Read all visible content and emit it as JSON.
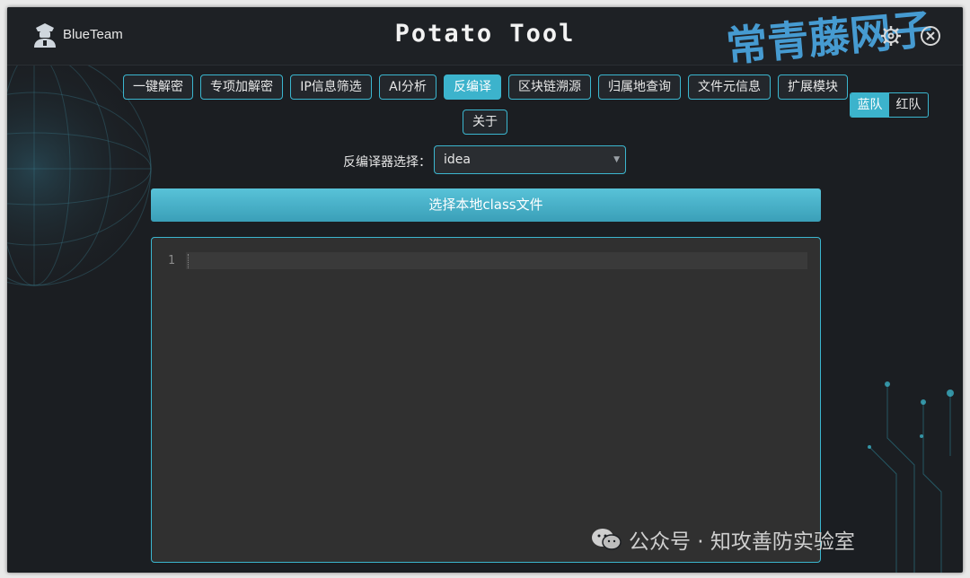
{
  "header": {
    "brand": "BlueTeam",
    "title": "Potato Tool",
    "watermark": "常青藤网子"
  },
  "nav": {
    "tabs": [
      {
        "label": "一键解密"
      },
      {
        "label": "专项加解密"
      },
      {
        "label": "IP信息筛选"
      },
      {
        "label": "AI分析"
      },
      {
        "label": "反编译"
      },
      {
        "label": "区块链溯源"
      },
      {
        "label": "归属地查询"
      },
      {
        "label": "文件元信息"
      },
      {
        "label": "扩展模块"
      },
      {
        "label": "关于"
      }
    ],
    "active": "反编译"
  },
  "team": {
    "blue": "蓝队",
    "red": "红队",
    "active": "蓝队"
  },
  "decompiler": {
    "label": "反编译器选择：",
    "selected": "idea",
    "file_button": "选择本地class文件"
  },
  "editor": {
    "line_number": "1"
  },
  "footer_watermark": "公众号 · 知攻善防实验室",
  "colors": {
    "accent": "#3cb3cc",
    "background": "#1b1e22",
    "editor_bg": "#303030"
  }
}
